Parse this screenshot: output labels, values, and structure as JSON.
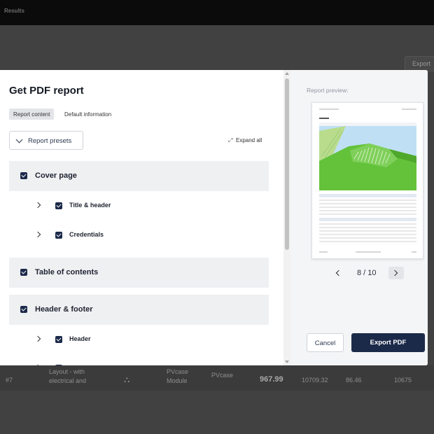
{
  "app": {
    "breadcrumb": "Results",
    "export_label": "Export",
    "bg_row": {
      "index": "#7",
      "name_line1": "Layout - with",
      "name_line2": "electrical and",
      "module_line1": "PVcase",
      "module_line2": "Module",
      "source": "PVcase",
      "value": "967.99",
      "col_a": "10709.32",
      "col_b": "86.46",
      "col_c": "10675"
    }
  },
  "modal": {
    "title": "Get PDF report",
    "tabs": {
      "report_content": "Report content",
      "default_information": "Default information"
    },
    "presets_label": "Report presets",
    "expand_all_label": "Expand all",
    "sections": {
      "cover_page": "Cover page",
      "title_header": "Title & header",
      "credentials": "Credentials",
      "table_of_contents": "Table of contents",
      "header_footer": "Header & footer",
      "header": "Header"
    },
    "preview": {
      "label": "Report preview:",
      "page_indicator": "8 / 10"
    },
    "cancel_label": "Cancel",
    "export_label": "Export PDF"
  },
  "colors": {
    "primary": "#1c2a4a",
    "terrain": "#63c23a",
    "water": "#bfe0f4"
  }
}
